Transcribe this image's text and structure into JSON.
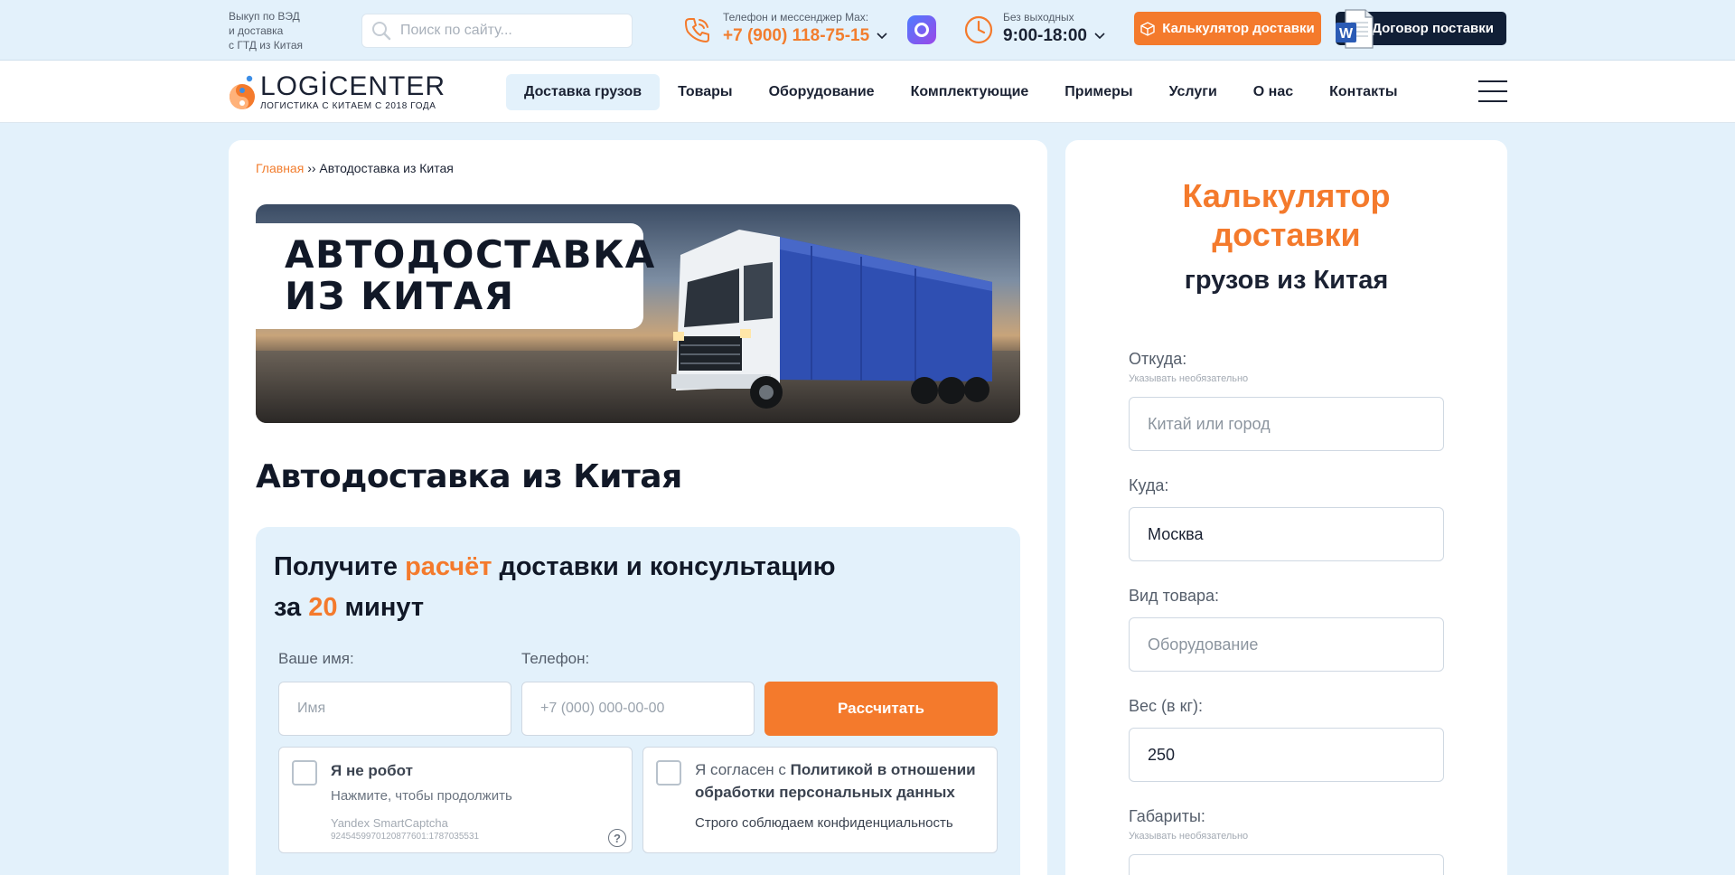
{
  "topbar": {
    "note_lines": [
      "Выкуп по ВЭД",
      "и доставка",
      "с ГТД из Китая"
    ],
    "search_placeholder": "Поиск по сайту...",
    "phone_caption": "Телефон и мессенджер Max:",
    "phone_number": "+7 (900) 118-75-15",
    "hours_caption": "Без выходных",
    "hours": "9:00-18:00",
    "calc_button": "Калькулятор доставки",
    "contract_button": "Договор поставки",
    "accent_color": "#f47a2c",
    "dark_color": "#111f36"
  },
  "logo": {
    "name_left": "LOGİ",
    "name_right": "CENTER",
    "tagline": "ЛОГИСТИКА С КИТАЕМ С 2018 ГОДА"
  },
  "nav": {
    "items": [
      "Доставка грузов",
      "Товары",
      "Оборудование",
      "Комплектующие",
      "Примеры",
      "Услуги",
      "О нас",
      "Контакты"
    ],
    "active_index": 0
  },
  "breadcrumb": {
    "home": "Главная",
    "separator": "››",
    "current": "Автодоставка из Китая"
  },
  "hero": {
    "line1": "АВТОДОСТАВКА",
    "line2": "ИЗ КИТАЯ",
    "image": "truck-on-highway"
  },
  "page_title": "Автодоставка из Китая",
  "lead_form": {
    "title_part1": "Получите ",
    "title_highlight1": "расчёт",
    "title_part2": " доставки и консультацию",
    "title_part3": "за ",
    "title_highlight2": "20",
    "title_part4": " минут",
    "name_label": "Ваше имя:",
    "name_placeholder": "Имя",
    "phone_label": "Телефон:",
    "phone_placeholder": "+7 (000) 000-00-00",
    "submit": "Рассчитать",
    "captcha_title": "Я не робот",
    "captcha_sub": "Нажмите, чтобы продолжить",
    "captcha_brand": "Yandex SmartCaptcha",
    "captcha_id": "9245459970120877601:1787035531",
    "captcha_help": "?",
    "consent_prefix": "Я согласен с ",
    "consent_link": "Политикой в отношении обработки персональных данных",
    "consent_note": "Строго соблюдаем конфиденциальность"
  },
  "calculator": {
    "title_line1": "Калькулятор",
    "title_line2": "доставки",
    "subtitle": "грузов из Китая",
    "from_label": "Откуда:",
    "from_hint": "Указывать необязательно",
    "from_placeholder": "Китай или город",
    "to_label": "Куда:",
    "to_value": "Москва",
    "goods_label": "Вид товара:",
    "goods_placeholder": "Оборудование",
    "weight_label": "Вес (в кг):",
    "weight_value": "250",
    "size_label": "Габариты:",
    "size_hint": "Указывать необязательно"
  }
}
